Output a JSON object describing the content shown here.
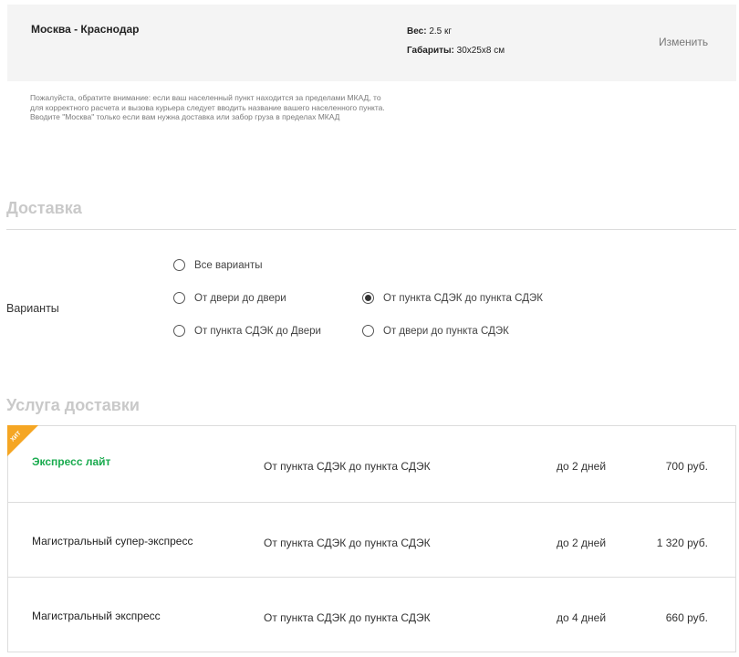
{
  "summary": {
    "route": "Москва - Краснодар",
    "weight_label": "Вес:",
    "weight_value": "2.5 кг",
    "dims_label": "Габариты:",
    "dims_value": "30x25x8 см",
    "change_label": "Изменить"
  },
  "notice": "Пожалуйста, обратите внимание: если ваш населенный пункт находится за пределами МКАД, то для корректного расчета и вызова курьера следует вводить название вашего населенного пункта. Вводите \"Москва\" только если вам нужна доставка или забор груза в пределах МКАД",
  "delivery": {
    "title": "Доставка",
    "options_label": "Варианты",
    "options": [
      {
        "label": "Все варианты",
        "checked": false
      },
      {
        "label": "От двери до двери",
        "checked": false
      },
      {
        "label": "От пункта СДЭК до пункта СДЭК",
        "checked": true
      },
      {
        "label": "От пункта СДЭК до Двери",
        "checked": false
      },
      {
        "label": "От двери до пункта СДЭК",
        "checked": false
      }
    ]
  },
  "service": {
    "title": "Услуга доставки",
    "badge": "ХИТ",
    "rows": [
      {
        "name": "Экспресс лайт",
        "type": "От пункта СДЭК до пункта СДЭК",
        "term": "до 2 дней",
        "price": "700 руб."
      },
      {
        "name": "Магистральный супер-экспресс",
        "type": "От пункта СДЭК до пункта СДЭК",
        "term": "до 2 дней",
        "price": "1 320 руб."
      },
      {
        "name": "Магистральный экспресс",
        "type": "От пункта СДЭК до пункта СДЭК",
        "term": "до 4 дней",
        "price": "660 руб."
      }
    ]
  },
  "colors": {
    "accent_green": "#1aab4f",
    "badge_orange": "#f5a623",
    "summary_bg": "#f4f4f4"
  }
}
